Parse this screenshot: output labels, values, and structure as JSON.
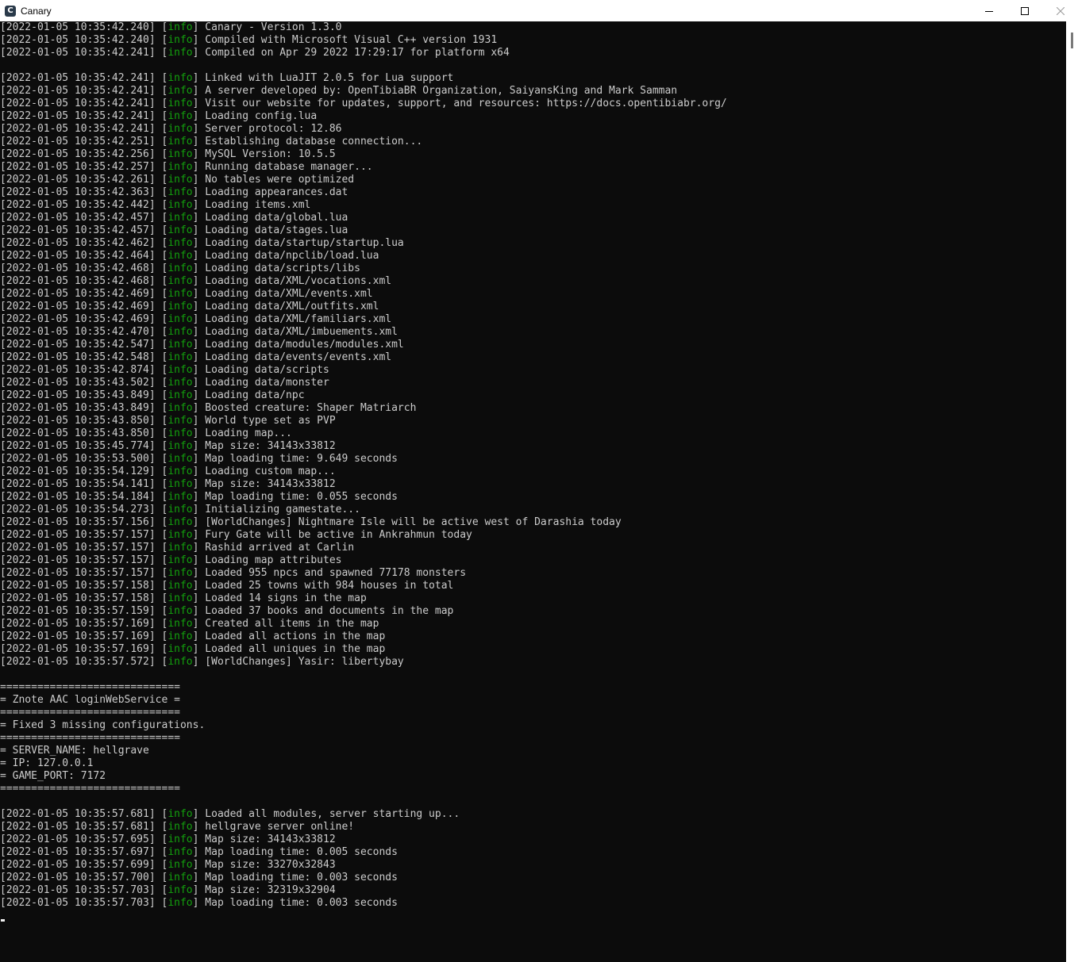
{
  "window": {
    "title": "Canary",
    "icon": "C",
    "buttons": [
      "minimize-icon",
      "maximize-icon",
      "close-icon"
    ]
  },
  "colors": {
    "text": "#cccccc",
    "level": "#13a10e",
    "background": "#0c0c0c"
  },
  "console": {
    "lines": [
      {
        "ts": "[2022-01-05 10:35:42.240]",
        "lvl": "info",
        "msg": "Canary - Version 1.3.0"
      },
      {
        "ts": "[2022-01-05 10:35:42.240]",
        "lvl": "info",
        "msg": "Compiled with Microsoft Visual C++ version 1931"
      },
      {
        "ts": "[2022-01-05 10:35:42.241]",
        "lvl": "info",
        "msg": "Compiled on Apr 29 2022 17:29:17 for platform x64"
      },
      {
        "text": ""
      },
      {
        "ts": "[2022-01-05 10:35:42.241]",
        "lvl": "info",
        "msg": "Linked with LuaJIT 2.0.5 for Lua support"
      },
      {
        "ts": "[2022-01-05 10:35:42.241]",
        "lvl": "info",
        "msg": "A server developed by: OpenTibiaBR Organization, SaiyansKing and Mark Samman"
      },
      {
        "ts": "[2022-01-05 10:35:42.241]",
        "lvl": "info",
        "msg": "Visit our website for updates, support, and resources: https://docs.opentibiabr.org/"
      },
      {
        "ts": "[2022-01-05 10:35:42.241]",
        "lvl": "info",
        "msg": "Loading config.lua"
      },
      {
        "ts": "[2022-01-05 10:35:42.241]",
        "lvl": "info",
        "msg": "Server protocol: 12.86"
      },
      {
        "ts": "[2022-01-05 10:35:42.251]",
        "lvl": "info",
        "msg": "Establishing database connection..."
      },
      {
        "ts": "[2022-01-05 10:35:42.256]",
        "lvl": "info",
        "msg": "MySQL Version: 10.5.5"
      },
      {
        "ts": "[2022-01-05 10:35:42.257]",
        "lvl": "info",
        "msg": "Running database manager..."
      },
      {
        "ts": "[2022-01-05 10:35:42.261]",
        "lvl": "info",
        "msg": "No tables were optimized"
      },
      {
        "ts": "[2022-01-05 10:35:42.363]",
        "lvl": "info",
        "msg": "Loading appearances.dat"
      },
      {
        "ts": "[2022-01-05 10:35:42.442]",
        "lvl": "info",
        "msg": "Loading items.xml"
      },
      {
        "ts": "[2022-01-05 10:35:42.457]",
        "lvl": "info",
        "msg": "Loading data/global.lua"
      },
      {
        "ts": "[2022-01-05 10:35:42.457]",
        "lvl": "info",
        "msg": "Loading data/stages.lua"
      },
      {
        "ts": "[2022-01-05 10:35:42.462]",
        "lvl": "info",
        "msg": "Loading data/startup/startup.lua"
      },
      {
        "ts": "[2022-01-05 10:35:42.464]",
        "lvl": "info",
        "msg": "Loading data/npclib/load.lua"
      },
      {
        "ts": "[2022-01-05 10:35:42.468]",
        "lvl": "info",
        "msg": "Loading data/scripts/libs"
      },
      {
        "ts": "[2022-01-05 10:35:42.468]",
        "lvl": "info",
        "msg": "Loading data/XML/vocations.xml"
      },
      {
        "ts": "[2022-01-05 10:35:42.469]",
        "lvl": "info",
        "msg": "Loading data/XML/events.xml"
      },
      {
        "ts": "[2022-01-05 10:35:42.469]",
        "lvl": "info",
        "msg": "Loading data/XML/outfits.xml"
      },
      {
        "ts": "[2022-01-05 10:35:42.469]",
        "lvl": "info",
        "msg": "Loading data/XML/familiars.xml"
      },
      {
        "ts": "[2022-01-05 10:35:42.470]",
        "lvl": "info",
        "msg": "Loading data/XML/imbuements.xml"
      },
      {
        "ts": "[2022-01-05 10:35:42.547]",
        "lvl": "info",
        "msg": "Loading data/modules/modules.xml"
      },
      {
        "ts": "[2022-01-05 10:35:42.548]",
        "lvl": "info",
        "msg": "Loading data/events/events.xml"
      },
      {
        "ts": "[2022-01-05 10:35:42.874]",
        "lvl": "info",
        "msg": "Loading data/scripts"
      },
      {
        "ts": "[2022-01-05 10:35:43.502]",
        "lvl": "info",
        "msg": "Loading data/monster"
      },
      {
        "ts": "[2022-01-05 10:35:43.849]",
        "lvl": "info",
        "msg": "Loading data/npc"
      },
      {
        "ts": "[2022-01-05 10:35:43.849]",
        "lvl": "info",
        "msg": "Boosted creature: Shaper Matriarch"
      },
      {
        "ts": "[2022-01-05 10:35:43.850]",
        "lvl": "info",
        "msg": "World type set as PVP"
      },
      {
        "ts": "[2022-01-05 10:35:43.850]",
        "lvl": "info",
        "msg": "Loading map..."
      },
      {
        "ts": "[2022-01-05 10:35:45.774]",
        "lvl": "info",
        "msg": "Map size: 34143x33812"
      },
      {
        "ts": "[2022-01-05 10:35:53.500]",
        "lvl": "info",
        "msg": "Map loading time: 9.649 seconds"
      },
      {
        "ts": "[2022-01-05 10:35:54.129]",
        "lvl": "info",
        "msg": "Loading custom map..."
      },
      {
        "ts": "[2022-01-05 10:35:54.141]",
        "lvl": "info",
        "msg": "Map size: 34143x33812"
      },
      {
        "ts": "[2022-01-05 10:35:54.184]",
        "lvl": "info",
        "msg": "Map loading time: 0.055 seconds"
      },
      {
        "ts": "[2022-01-05 10:35:54.273]",
        "lvl": "info",
        "msg": "Initializing gamestate..."
      },
      {
        "ts": "[2022-01-05 10:35:57.156]",
        "lvl": "info",
        "msg": "[WorldChanges] Nightmare Isle will be active west of Darashia today"
      },
      {
        "ts": "[2022-01-05 10:35:57.157]",
        "lvl": "info",
        "msg": "Fury Gate will be active in Ankrahmun today"
      },
      {
        "ts": "[2022-01-05 10:35:57.157]",
        "lvl": "info",
        "msg": "Rashid arrived at Carlin"
      },
      {
        "ts": "[2022-01-05 10:35:57.157]",
        "lvl": "info",
        "msg": "Loading map attributes"
      },
      {
        "ts": "[2022-01-05 10:35:57.157]",
        "lvl": "info",
        "msg": "Loaded 955 npcs and spawned 77178 monsters"
      },
      {
        "ts": "[2022-01-05 10:35:57.158]",
        "lvl": "info",
        "msg": "Loaded 25 towns with 984 houses in total"
      },
      {
        "ts": "[2022-01-05 10:35:57.158]",
        "lvl": "info",
        "msg": "Loaded 14 signs in the map"
      },
      {
        "ts": "[2022-01-05 10:35:57.159]",
        "lvl": "info",
        "msg": "Loaded 37 books and documents in the map"
      },
      {
        "ts": "[2022-01-05 10:35:57.169]",
        "lvl": "info",
        "msg": "Created all items in the map"
      },
      {
        "ts": "[2022-01-05 10:35:57.169]",
        "lvl": "info",
        "msg": "Loaded all actions in the map"
      },
      {
        "ts": "[2022-01-05 10:35:57.169]",
        "lvl": "info",
        "msg": "Loaded all uniques in the map"
      },
      {
        "ts": "[2022-01-05 10:35:57.572]",
        "lvl": "info",
        "msg": "[WorldChanges] Yasir: libertybay"
      },
      {
        "text": ""
      },
      {
        "text": "============================="
      },
      {
        "text": "= Znote AAC loginWebService ="
      },
      {
        "text": "============================="
      },
      {
        "text": "= Fixed 3 missing configurations."
      },
      {
        "text": "============================="
      },
      {
        "text": "= SERVER_NAME: hellgrave"
      },
      {
        "text": "= IP: 127.0.0.1"
      },
      {
        "text": "= GAME_PORT: 7172"
      },
      {
        "text": "============================="
      },
      {
        "text": ""
      },
      {
        "ts": "[2022-01-05 10:35:57.681]",
        "lvl": "info",
        "msg": "Loaded all modules, server starting up..."
      },
      {
        "ts": "[2022-01-05 10:35:57.681]",
        "lvl": "info",
        "msg": "hellgrave server online!"
      },
      {
        "ts": "[2022-01-05 10:35:57.695]",
        "lvl": "info",
        "msg": "Map size: 34143x33812"
      },
      {
        "ts": "[2022-01-05 10:35:57.697]",
        "lvl": "info",
        "msg": "Map loading time: 0.005 seconds"
      },
      {
        "ts": "[2022-01-05 10:35:57.699]",
        "lvl": "info",
        "msg": "Map size: 33270x32843"
      },
      {
        "ts": "[2022-01-05 10:35:57.700]",
        "lvl": "info",
        "msg": "Map loading time: 0.003 seconds"
      },
      {
        "ts": "[2022-01-05 10:35:57.703]",
        "lvl": "info",
        "msg": "Map size: 32319x32904"
      },
      {
        "ts": "[2022-01-05 10:35:57.703]",
        "lvl": "info",
        "msg": "Map loading time: 0.003 seconds"
      }
    ]
  }
}
